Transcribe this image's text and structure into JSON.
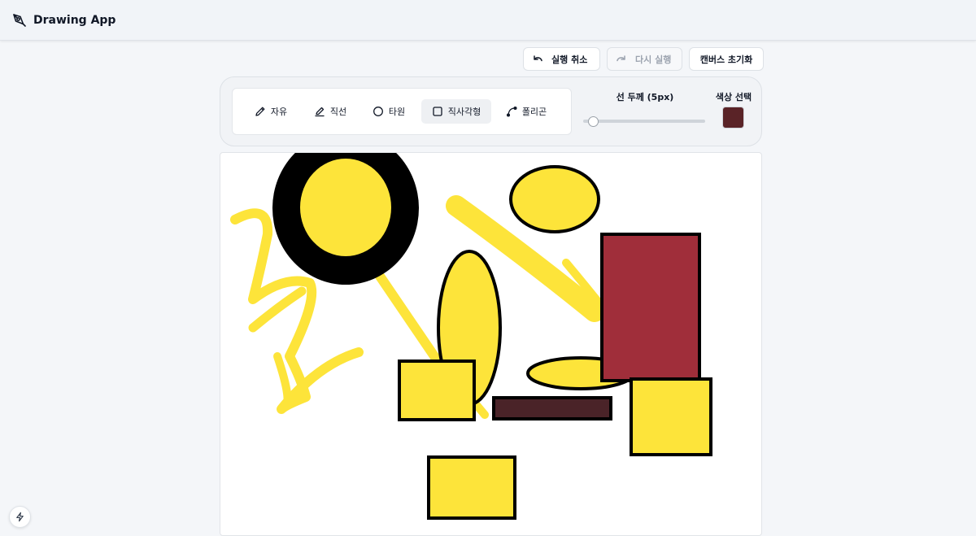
{
  "header": {
    "title": "Drawing App",
    "logo_icon": "pen-tool-icon"
  },
  "history": {
    "undo_label": "실행 취소",
    "redo_label": "다시 실행",
    "reset_label": "캔버스 초기화",
    "redo_disabled": true
  },
  "tools": {
    "active": "rect",
    "items": [
      {
        "id": "free",
        "label": "자유",
        "icon": "pencil-icon"
      },
      {
        "id": "line",
        "label": "직선",
        "icon": "pen-icon"
      },
      {
        "id": "ellipse",
        "label": "타원",
        "icon": "circle-icon"
      },
      {
        "id": "rect",
        "label": "직사각형",
        "icon": "square-icon"
      },
      {
        "id": "polygon",
        "label": "폴리곤",
        "icon": "spline-icon"
      }
    ]
  },
  "stroke": {
    "label": "선 두께 (5px)",
    "value": 5,
    "min": 1,
    "max": 100
  },
  "color": {
    "label": "색상 선택",
    "current": "#5a2327"
  },
  "palette": {
    "fill_yellow": "#fde43a",
    "outline": "#000000",
    "rect_red": "#a02e3a",
    "bar_dark": "#4a2328"
  }
}
